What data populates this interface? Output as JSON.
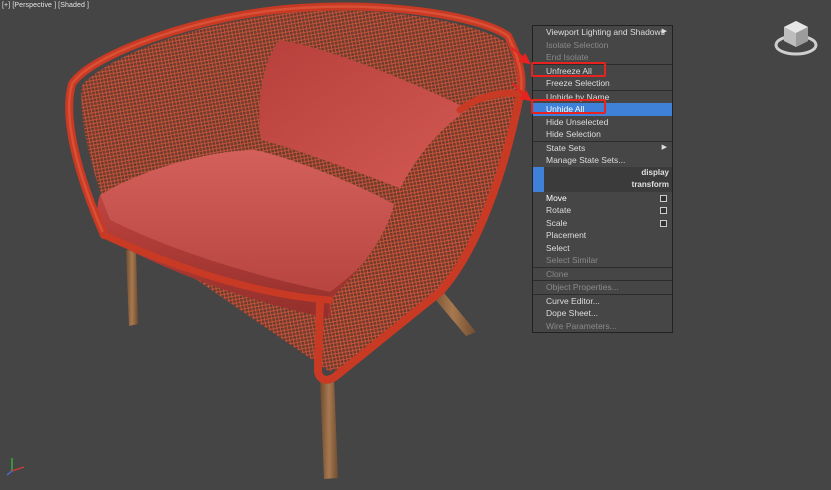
{
  "viewport": {
    "label": "[+] [Perspective ] [Shaded ]"
  },
  "quad_menu": {
    "sections": [
      {
        "items": [
          {
            "label": "Viewport Lighting and Shadows",
            "submenu": true,
            "disabled": false
          },
          {
            "label": "Isolate Selection",
            "disabled": true
          },
          {
            "label": "End Isolate",
            "disabled": true
          }
        ]
      },
      {
        "items": [
          {
            "label": "Unfreeze All",
            "disabled": false,
            "annotated": true
          },
          {
            "label": "Freeze Selection",
            "disabled": false
          }
        ]
      },
      {
        "items": [
          {
            "label": "Unhide by Name",
            "disabled": false
          },
          {
            "label": "Unhide All",
            "disabled": false,
            "highlighted": true,
            "annotated": true
          },
          {
            "label": "Hide Unselected",
            "disabled": false
          },
          {
            "label": "Hide Selection",
            "disabled": false
          }
        ]
      },
      {
        "items": [
          {
            "label": "State Sets",
            "submenu": true,
            "disabled": false
          },
          {
            "label": "Manage State Sets...",
            "disabled": false
          }
        ]
      }
    ],
    "headers": {
      "display": "display",
      "transform": "transform"
    },
    "transform_items": [
      {
        "label": "Move",
        "disabled": false,
        "bold": true,
        "settings": true
      },
      {
        "label": "Rotate",
        "disabled": false,
        "settings": true
      },
      {
        "label": "Scale",
        "disabled": false,
        "settings": true
      },
      {
        "label": "Placement",
        "disabled": false
      },
      {
        "label": "Select",
        "disabled": false
      },
      {
        "label": "Select Similar",
        "disabled": true
      }
    ],
    "extra_sections": [
      {
        "items": [
          {
            "label": "Clone",
            "disabled": true
          }
        ]
      },
      {
        "items": [
          {
            "label": "Object Properties...",
            "disabled": true
          }
        ]
      },
      {
        "items": [
          {
            "label": "Curve Editor...",
            "disabled": false
          },
          {
            "label": "Dope Sheet...",
            "disabled": false
          },
          {
            "label": "Wire Parameters...",
            "disabled": true
          }
        ]
      }
    ]
  },
  "colors": {
    "annotation": "#e8231f",
    "highlight": "#3f80d8",
    "chair_frame": "#c93a24",
    "cushion": "#c44a45",
    "legs": "#9a6e48"
  }
}
